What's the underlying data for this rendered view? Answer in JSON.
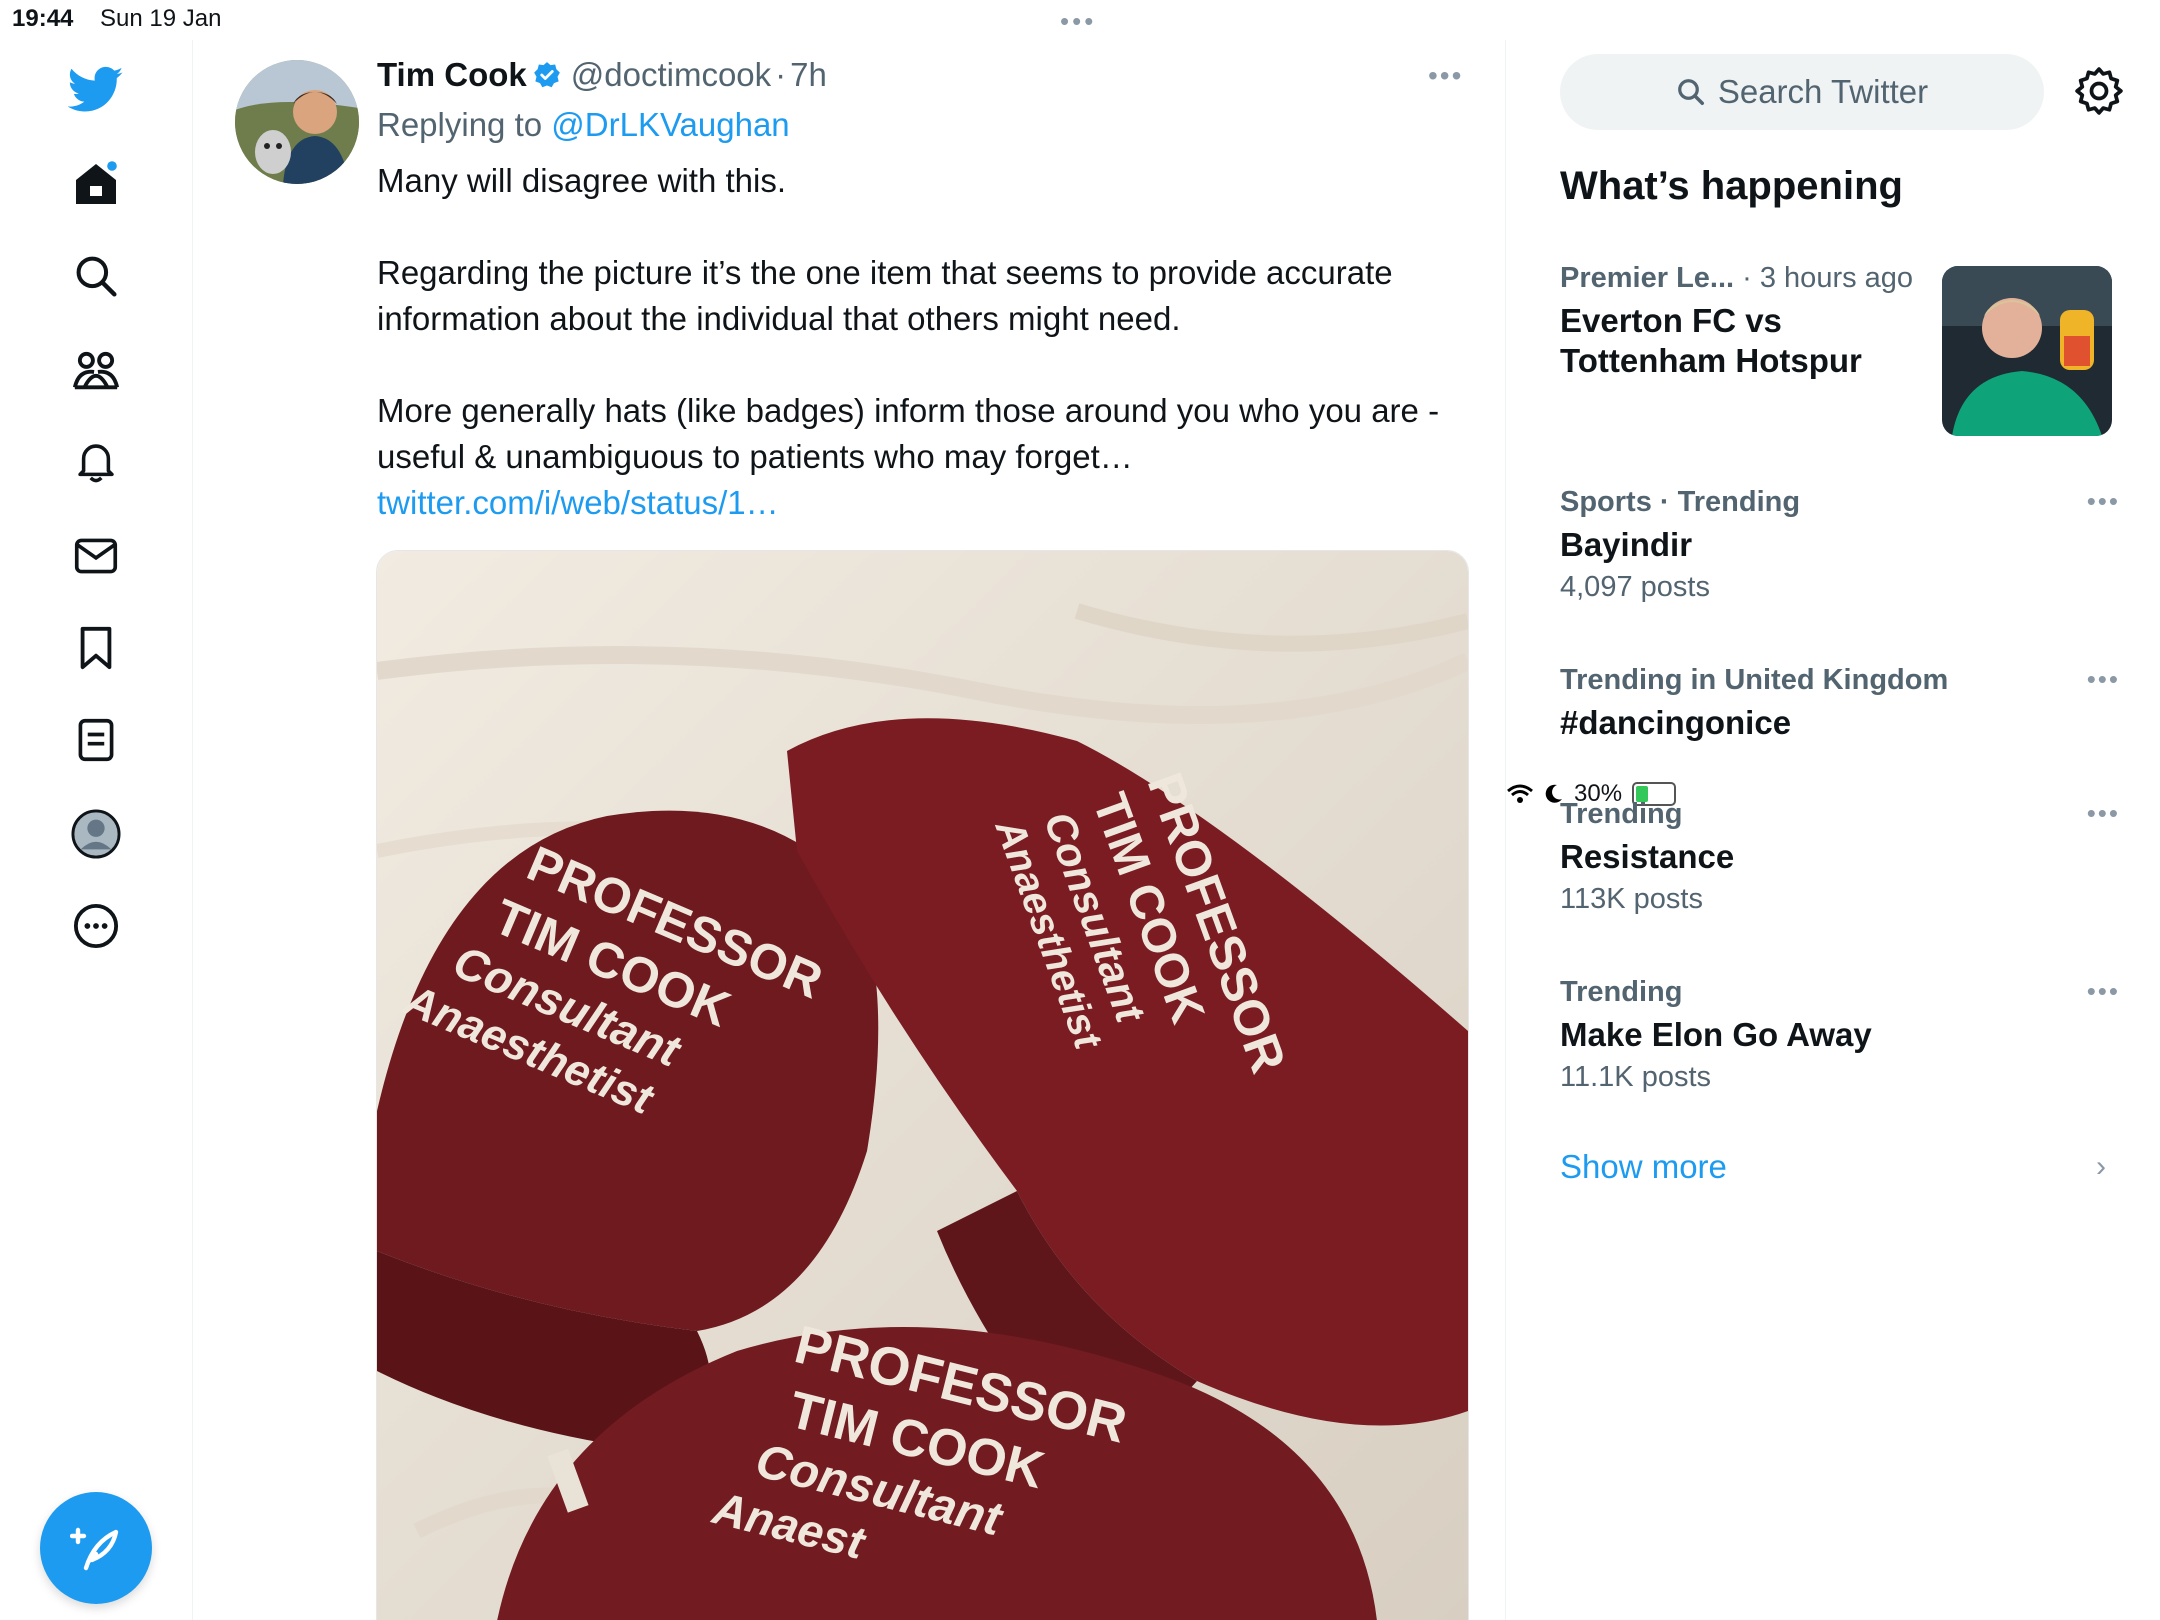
{
  "status_bar": {
    "time": "19:44",
    "date": "Sun 19 Jan",
    "battery": "30%",
    "battery_level": 0.3
  },
  "nav": {
    "items": [
      {
        "name": "twitter-logo-icon"
      },
      {
        "name": "home-icon"
      },
      {
        "name": "search-icon"
      },
      {
        "name": "communities-icon"
      },
      {
        "name": "notifications-icon"
      },
      {
        "name": "messages-icon"
      },
      {
        "name": "bookmarks-icon"
      },
      {
        "name": "lists-icon"
      },
      {
        "name": "profile-icon"
      },
      {
        "name": "more-icon"
      }
    ],
    "compose": "compose-icon"
  },
  "tweet": {
    "author_name": "Tim Cook",
    "handle": "@doctimcook",
    "separator": "·",
    "time": "7h",
    "replying_label": "Replying to",
    "replying_to": "@DrLKVaughan",
    "text_p1": "Many will disagree with this.",
    "text_p2": "Regarding the picture it’s the one item that seems to provide accurate information about the individual that others might need.",
    "text_p3": "More generally hats (like badges) inform those around you who you are -useful & unambiguous to patients who may forget… ",
    "link": "twitter.com/i/web/status/1…",
    "image_text": {
      "cap1": [
        "PROFESSOR",
        "TIM COOK",
        "Consultant",
        "Anaesthetist"
      ],
      "cap2": [
        "PROFESSOR",
        "TIM COOK",
        "Consultant",
        "Anaesthetist"
      ],
      "cap3": [
        "PROFESSOR",
        "TIM COOK",
        "Consultant",
        "Anaest"
      ]
    }
  },
  "sidebar": {
    "search_placeholder": "Search Twitter",
    "heading": "What’s happening",
    "trends": [
      {
        "context": "Premier Le...",
        "time": "· 3 hours ago",
        "title": "Everton FC vs Tottenham Hotspur"
      },
      {
        "context": "Sports · Trending",
        "title": "Bayindir",
        "count": "4,097 posts"
      },
      {
        "context": "Trending in United Kingdom",
        "title": "#dancingonice"
      },
      {
        "context": "Trending",
        "title": "Resistance",
        "count": "113K posts"
      },
      {
        "context": "Trending",
        "title": "Make Elon Go Away",
        "count": "11.1K posts"
      }
    ],
    "show_more": "Show more"
  },
  "colors": {
    "accent": "#1d9bf0",
    "secondary_text": "#536471",
    "primary_text": "#0f1419",
    "cap_maroon": "#6e1a1f"
  }
}
